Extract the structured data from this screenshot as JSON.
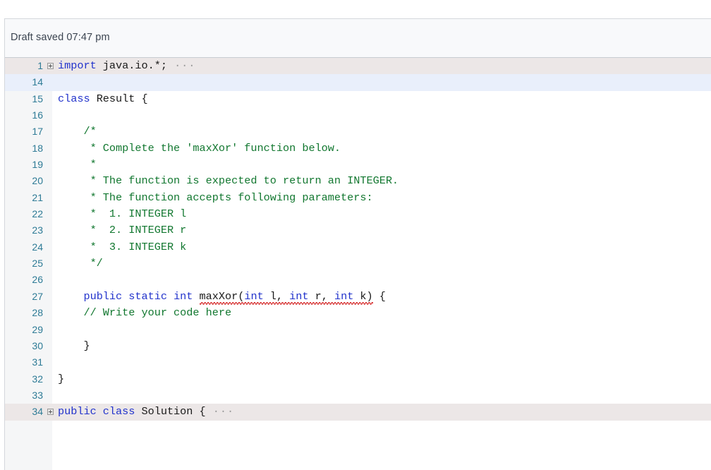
{
  "status": {
    "text": "Draft saved 07:47 pm"
  },
  "editor": {
    "language": "java",
    "colors": {
      "keyword": "#2233cc",
      "comment": "#11772f",
      "plain": "#1a1a1a",
      "line_number": "#2e7b96",
      "folded_row_bg": "#ece7e7",
      "current_line_bg": "#e9effb",
      "gutter_bg": "#f5f6f7",
      "error_squiggle": "#d83a3a"
    },
    "fold_icon": "plus-box-icon",
    "fold_ellipsis": "···",
    "lines": [
      {
        "number": "1",
        "state": "folded",
        "fold": true,
        "ellipsis": true,
        "tokens": [
          {
            "t": "import",
            "c": "kw"
          },
          {
            "t": " java.io.*;",
            "c": "plain"
          }
        ]
      },
      {
        "number": "14",
        "state": "current",
        "fold": false,
        "ellipsis": false,
        "tokens": []
      },
      {
        "number": "15",
        "state": "normal",
        "fold": false,
        "ellipsis": false,
        "tokens": [
          {
            "t": "class",
            "c": "kw"
          },
          {
            "t": " Result {",
            "c": "plain"
          }
        ]
      },
      {
        "number": "16",
        "state": "normal",
        "fold": false,
        "ellipsis": false,
        "tokens": []
      },
      {
        "number": "17",
        "state": "normal",
        "fold": false,
        "ellipsis": false,
        "tokens": [
          {
            "t": "    /*",
            "c": "cmt"
          }
        ]
      },
      {
        "number": "18",
        "state": "normal",
        "fold": false,
        "ellipsis": false,
        "tokens": [
          {
            "t": "     * Complete the 'maxXor' function below.",
            "c": "cmt"
          }
        ]
      },
      {
        "number": "19",
        "state": "normal",
        "fold": false,
        "ellipsis": false,
        "tokens": [
          {
            "t": "     *",
            "c": "cmt"
          }
        ]
      },
      {
        "number": "20",
        "state": "normal",
        "fold": false,
        "ellipsis": false,
        "tokens": [
          {
            "t": "     * The function is expected to return an INTEGER.",
            "c": "cmt"
          }
        ]
      },
      {
        "number": "21",
        "state": "normal",
        "fold": false,
        "ellipsis": false,
        "tokens": [
          {
            "t": "     * The function accepts following parameters:",
            "c": "cmt"
          }
        ]
      },
      {
        "number": "22",
        "state": "normal",
        "fold": false,
        "ellipsis": false,
        "tokens": [
          {
            "t": "     *  1. INTEGER l",
            "c": "cmt"
          }
        ]
      },
      {
        "number": "23",
        "state": "normal",
        "fold": false,
        "ellipsis": false,
        "tokens": [
          {
            "t": "     *  2. INTEGER r",
            "c": "cmt"
          }
        ]
      },
      {
        "number": "24",
        "state": "normal",
        "fold": false,
        "ellipsis": false,
        "tokens": [
          {
            "t": "     *  3. INTEGER k",
            "c": "cmt"
          }
        ]
      },
      {
        "number": "25",
        "state": "normal",
        "fold": false,
        "ellipsis": false,
        "tokens": [
          {
            "t": "     */",
            "c": "cmt"
          }
        ]
      },
      {
        "number": "26",
        "state": "normal",
        "fold": false,
        "ellipsis": false,
        "tokens": []
      },
      {
        "number": "27",
        "state": "normal",
        "fold": false,
        "ellipsis": false,
        "tokens": [
          {
            "t": "    ",
            "c": "plain"
          },
          {
            "t": "public static int ",
            "c": "kw"
          },
          {
            "t": "maxXor(",
            "c": "plain",
            "err": true
          },
          {
            "t": "int",
            "c": "kw",
            "err": true
          },
          {
            "t": " l, ",
            "c": "plain",
            "err": true
          },
          {
            "t": "int",
            "c": "kw",
            "err": true
          },
          {
            "t": " r, ",
            "c": "plain",
            "err": true
          },
          {
            "t": "int",
            "c": "kw",
            "err": true
          },
          {
            "t": " k)",
            "c": "plain",
            "err": true
          },
          {
            "t": " {",
            "c": "plain"
          }
        ]
      },
      {
        "number": "28",
        "state": "normal",
        "fold": false,
        "ellipsis": false,
        "tokens": [
          {
            "t": "    // Write your code here",
            "c": "cmt"
          }
        ]
      },
      {
        "number": "29",
        "state": "normal",
        "fold": false,
        "ellipsis": false,
        "tokens": []
      },
      {
        "number": "30",
        "state": "normal",
        "fold": false,
        "ellipsis": false,
        "tokens": [
          {
            "t": "    }",
            "c": "plain"
          }
        ]
      },
      {
        "number": "31",
        "state": "normal",
        "fold": false,
        "ellipsis": false,
        "tokens": []
      },
      {
        "number": "32",
        "state": "normal",
        "fold": false,
        "ellipsis": false,
        "tokens": [
          {
            "t": "}",
            "c": "plain"
          }
        ]
      },
      {
        "number": "33",
        "state": "normal",
        "fold": false,
        "ellipsis": false,
        "tokens": []
      },
      {
        "number": "34",
        "state": "folded",
        "fold": true,
        "ellipsis": true,
        "tokens": [
          {
            "t": "public class",
            "c": "kw"
          },
          {
            "t": " Solution {",
            "c": "plain"
          }
        ]
      }
    ]
  }
}
